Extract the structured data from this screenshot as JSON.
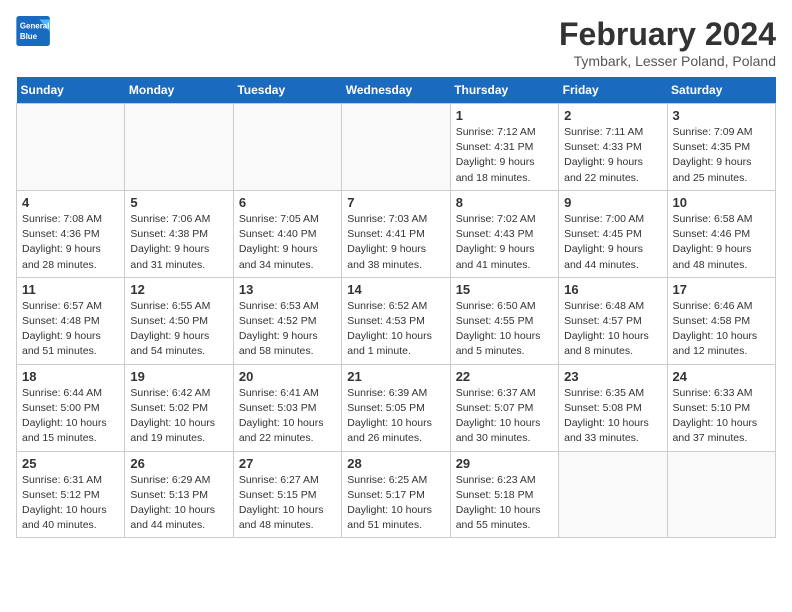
{
  "logo": {
    "line1": "General",
    "line2": "Blue"
  },
  "title": "February 2024",
  "subtitle": "Tymbark, Lesser Poland, Poland",
  "weekdays": [
    "Sunday",
    "Monday",
    "Tuesday",
    "Wednesday",
    "Thursday",
    "Friday",
    "Saturday"
  ],
  "weeks": [
    [
      {
        "day": "",
        "info": ""
      },
      {
        "day": "",
        "info": ""
      },
      {
        "day": "",
        "info": ""
      },
      {
        "day": "",
        "info": ""
      },
      {
        "day": "1",
        "info": "Sunrise: 7:12 AM\nSunset: 4:31 PM\nDaylight: 9 hours\nand 18 minutes."
      },
      {
        "day": "2",
        "info": "Sunrise: 7:11 AM\nSunset: 4:33 PM\nDaylight: 9 hours\nand 22 minutes."
      },
      {
        "day": "3",
        "info": "Sunrise: 7:09 AM\nSunset: 4:35 PM\nDaylight: 9 hours\nand 25 minutes."
      }
    ],
    [
      {
        "day": "4",
        "info": "Sunrise: 7:08 AM\nSunset: 4:36 PM\nDaylight: 9 hours\nand 28 minutes."
      },
      {
        "day": "5",
        "info": "Sunrise: 7:06 AM\nSunset: 4:38 PM\nDaylight: 9 hours\nand 31 minutes."
      },
      {
        "day": "6",
        "info": "Sunrise: 7:05 AM\nSunset: 4:40 PM\nDaylight: 9 hours\nand 34 minutes."
      },
      {
        "day": "7",
        "info": "Sunrise: 7:03 AM\nSunset: 4:41 PM\nDaylight: 9 hours\nand 38 minutes."
      },
      {
        "day": "8",
        "info": "Sunrise: 7:02 AM\nSunset: 4:43 PM\nDaylight: 9 hours\nand 41 minutes."
      },
      {
        "day": "9",
        "info": "Sunrise: 7:00 AM\nSunset: 4:45 PM\nDaylight: 9 hours\nand 44 minutes."
      },
      {
        "day": "10",
        "info": "Sunrise: 6:58 AM\nSunset: 4:46 PM\nDaylight: 9 hours\nand 48 minutes."
      }
    ],
    [
      {
        "day": "11",
        "info": "Sunrise: 6:57 AM\nSunset: 4:48 PM\nDaylight: 9 hours\nand 51 minutes."
      },
      {
        "day": "12",
        "info": "Sunrise: 6:55 AM\nSunset: 4:50 PM\nDaylight: 9 hours\nand 54 minutes."
      },
      {
        "day": "13",
        "info": "Sunrise: 6:53 AM\nSunset: 4:52 PM\nDaylight: 9 hours\nand 58 minutes."
      },
      {
        "day": "14",
        "info": "Sunrise: 6:52 AM\nSunset: 4:53 PM\nDaylight: 10 hours\nand 1 minute."
      },
      {
        "day": "15",
        "info": "Sunrise: 6:50 AM\nSunset: 4:55 PM\nDaylight: 10 hours\nand 5 minutes."
      },
      {
        "day": "16",
        "info": "Sunrise: 6:48 AM\nSunset: 4:57 PM\nDaylight: 10 hours\nand 8 minutes."
      },
      {
        "day": "17",
        "info": "Sunrise: 6:46 AM\nSunset: 4:58 PM\nDaylight: 10 hours\nand 12 minutes."
      }
    ],
    [
      {
        "day": "18",
        "info": "Sunrise: 6:44 AM\nSunset: 5:00 PM\nDaylight: 10 hours\nand 15 minutes."
      },
      {
        "day": "19",
        "info": "Sunrise: 6:42 AM\nSunset: 5:02 PM\nDaylight: 10 hours\nand 19 minutes."
      },
      {
        "day": "20",
        "info": "Sunrise: 6:41 AM\nSunset: 5:03 PM\nDaylight: 10 hours\nand 22 minutes."
      },
      {
        "day": "21",
        "info": "Sunrise: 6:39 AM\nSunset: 5:05 PM\nDaylight: 10 hours\nand 26 minutes."
      },
      {
        "day": "22",
        "info": "Sunrise: 6:37 AM\nSunset: 5:07 PM\nDaylight: 10 hours\nand 30 minutes."
      },
      {
        "day": "23",
        "info": "Sunrise: 6:35 AM\nSunset: 5:08 PM\nDaylight: 10 hours\nand 33 minutes."
      },
      {
        "day": "24",
        "info": "Sunrise: 6:33 AM\nSunset: 5:10 PM\nDaylight: 10 hours\nand 37 minutes."
      }
    ],
    [
      {
        "day": "25",
        "info": "Sunrise: 6:31 AM\nSunset: 5:12 PM\nDaylight: 10 hours\nand 40 minutes."
      },
      {
        "day": "26",
        "info": "Sunrise: 6:29 AM\nSunset: 5:13 PM\nDaylight: 10 hours\nand 44 minutes."
      },
      {
        "day": "27",
        "info": "Sunrise: 6:27 AM\nSunset: 5:15 PM\nDaylight: 10 hours\nand 48 minutes."
      },
      {
        "day": "28",
        "info": "Sunrise: 6:25 AM\nSunset: 5:17 PM\nDaylight: 10 hours\nand 51 minutes."
      },
      {
        "day": "29",
        "info": "Sunrise: 6:23 AM\nSunset: 5:18 PM\nDaylight: 10 hours\nand 55 minutes."
      },
      {
        "day": "",
        "info": ""
      },
      {
        "day": "",
        "info": ""
      }
    ]
  ]
}
